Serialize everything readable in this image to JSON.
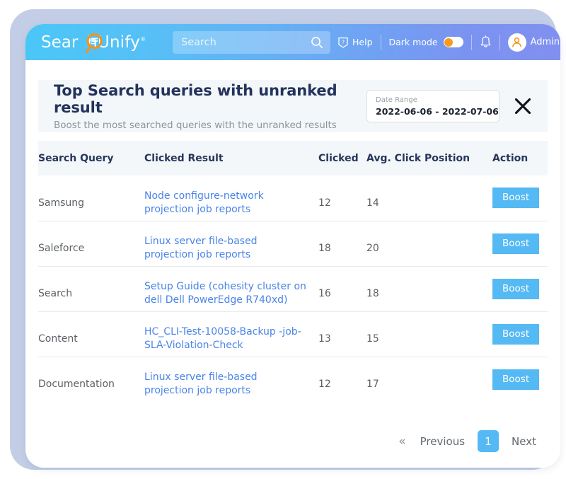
{
  "brand": {
    "logo_text_before": "Sear",
    "logo_text_hidden_c": "c",
    "logo_text_after": "hUnify",
    "logo_trademark": "®",
    "accent_orange": "#f4921e",
    "accent_blue": "#55b9f3",
    "navbar_gradient_start": "#4ac6f7",
    "navbar_gradient_end": "#8190ef"
  },
  "navbar": {
    "search_placeholder": "Search",
    "help_label": "Help",
    "dark_mode_label": "Dark mode",
    "dark_mode_on": false,
    "admin_label": "Admin"
  },
  "panel": {
    "title": "Top Search queries with unranked result",
    "subtitle": "Boost the most searched queries with the unranked results",
    "date_range_label": "Date Range",
    "date_range_value": "2022-06-06 - 2022-07-06",
    "close_label": "×"
  },
  "table": {
    "columns": [
      "Search Query",
      "Clicked Result",
      "Clicked",
      "Avg. Click Position",
      "Action"
    ],
    "rows": [
      {
        "query": "Samsung",
        "result": "Node configure-network projection job reports",
        "clicked": "12",
        "avg_click_position": "14",
        "action": "Boost"
      },
      {
        "query": "Saleforce",
        "result": "Linux server file-based projection job reports",
        "clicked": "18",
        "avg_click_position": "20",
        "action": "Boost"
      },
      {
        "query": "Search",
        "result": "Setup Guide (cohesity cluster on dell Dell PowerEdge R740xd)",
        "clicked": "16",
        "avg_click_position": "18",
        "action": "Boost"
      },
      {
        "query": "Content",
        "result": "HC_CLI-Test-10058-Backup -job-SLA-Violation-Check",
        "clicked": "13",
        "avg_click_position": "15",
        "action": "Boost"
      },
      {
        "query": "Documentation",
        "result": "Linux server file-based projection job reports",
        "clicked": "12",
        "avg_click_position": "17",
        "action": "Boost"
      }
    ]
  },
  "pagination": {
    "prev_chevron": "«",
    "prev_label": "Previous",
    "current_page": "1",
    "next_label": "Next"
  }
}
